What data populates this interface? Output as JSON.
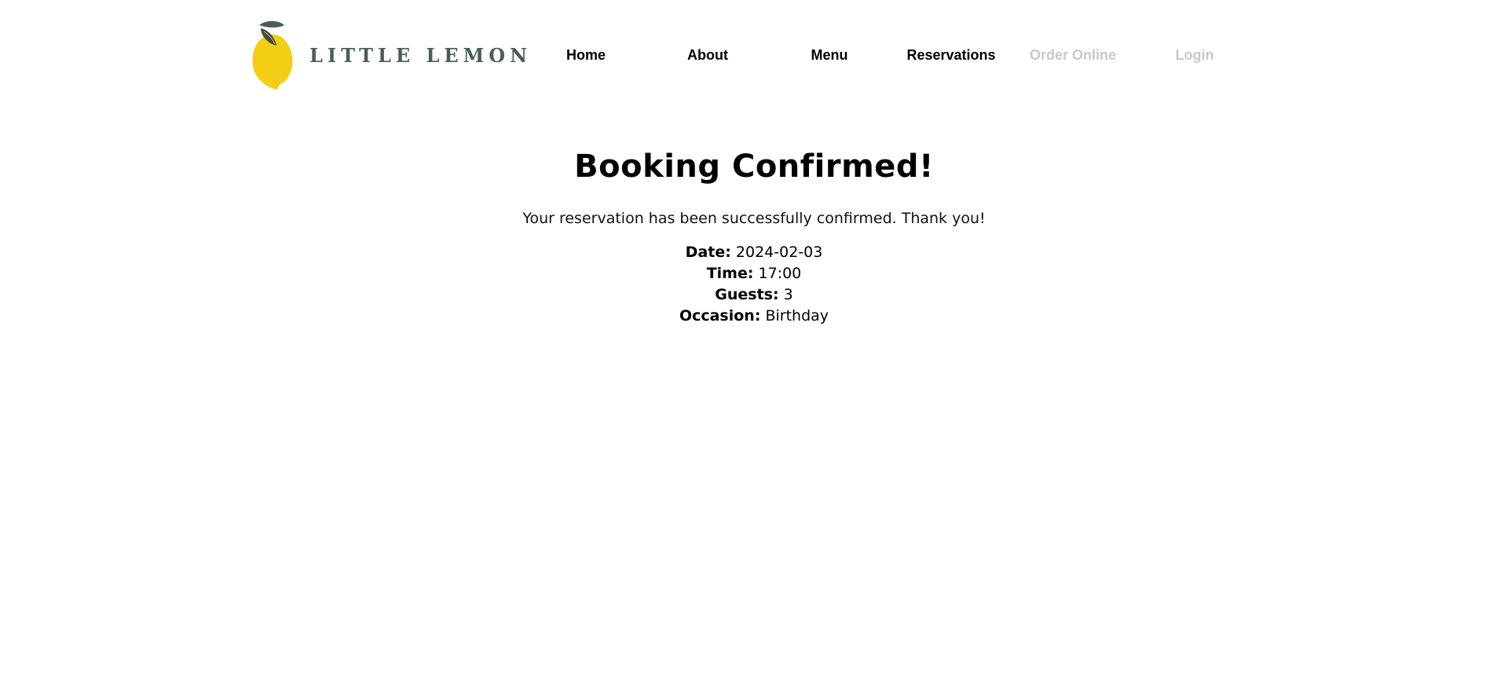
{
  "brand": {
    "name": "LITTLE LEMON",
    "lemon_color": "#f4ce14",
    "leaf_color": "#495e57",
    "text_color": "#495e57"
  },
  "nav": {
    "items": [
      {
        "label": "Home",
        "enabled": true
      },
      {
        "label": "About",
        "enabled": true
      },
      {
        "label": "Menu",
        "enabled": true
      },
      {
        "label": "Reservations",
        "enabled": true
      },
      {
        "label": "Order Online",
        "enabled": false
      },
      {
        "label": "Login",
        "enabled": false
      }
    ],
    "disabled_color": "#c8c8c8"
  },
  "confirmation": {
    "title": "Booking Confirmed!",
    "message": "Your reservation has been successfully confirmed. Thank you!",
    "details": [
      {
        "label": "Date:",
        "value": "2024-02-03"
      },
      {
        "label": "Time:",
        "value": "17:00"
      },
      {
        "label": "Guests:",
        "value": "3"
      },
      {
        "label": "Occasion:",
        "value": "Birthday"
      }
    ]
  }
}
